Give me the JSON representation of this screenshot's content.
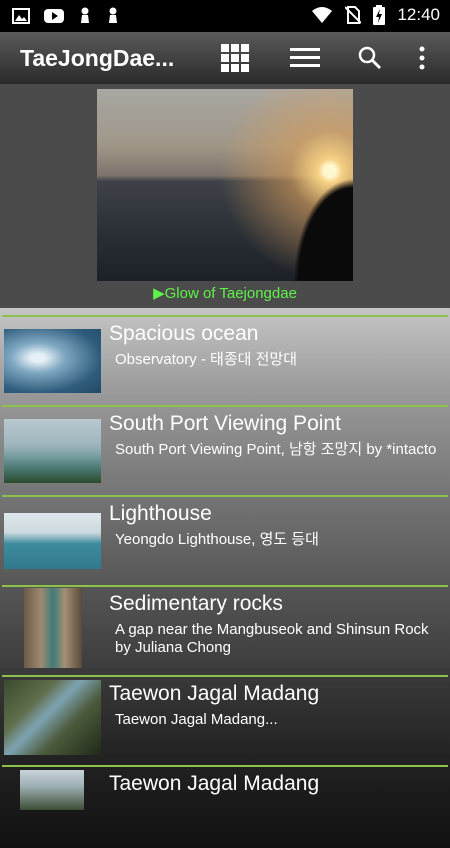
{
  "status": {
    "time": "12:40"
  },
  "appbar": {
    "title": "TaeJongDae..."
  },
  "hero": {
    "caption": "▶Glow of Taejongdae"
  },
  "items": [
    {
      "title": "Spacious ocean",
      "subtitle": "Observatory - 태종대 전망대"
    },
    {
      "title": "South Port Viewing Point",
      "subtitle": "South Port Viewing Point, 남항 조망지 by *intacto"
    },
    {
      "title": "Lighthouse",
      "subtitle": "Yeongdo Lighthouse, 영도 등대"
    },
    {
      "title": "Sedimentary rocks",
      "subtitle": "A gap near the Mangbuseok and Shinsun Rock by Juliana Chong"
    },
    {
      "title": "Taewon Jagal Madang",
      "subtitle": "Taewon Jagal Madang..."
    },
    {
      "title": "Taewon Jagal Madang",
      "subtitle": ""
    }
  ],
  "icons": {
    "status_left": [
      "image-icon",
      "youtube-icon",
      "chess-pawn-icon",
      "chess-pawn-icon"
    ],
    "status_right": [
      "wifi-icon",
      "no-sim-icon",
      "battery-charging-icon"
    ],
    "appbar": [
      "grid-view-icon",
      "list-view-icon",
      "search-icon",
      "overflow-menu-icon"
    ]
  },
  "colors": {
    "accent": "#8bc34a",
    "caption": "#5ef34a"
  }
}
